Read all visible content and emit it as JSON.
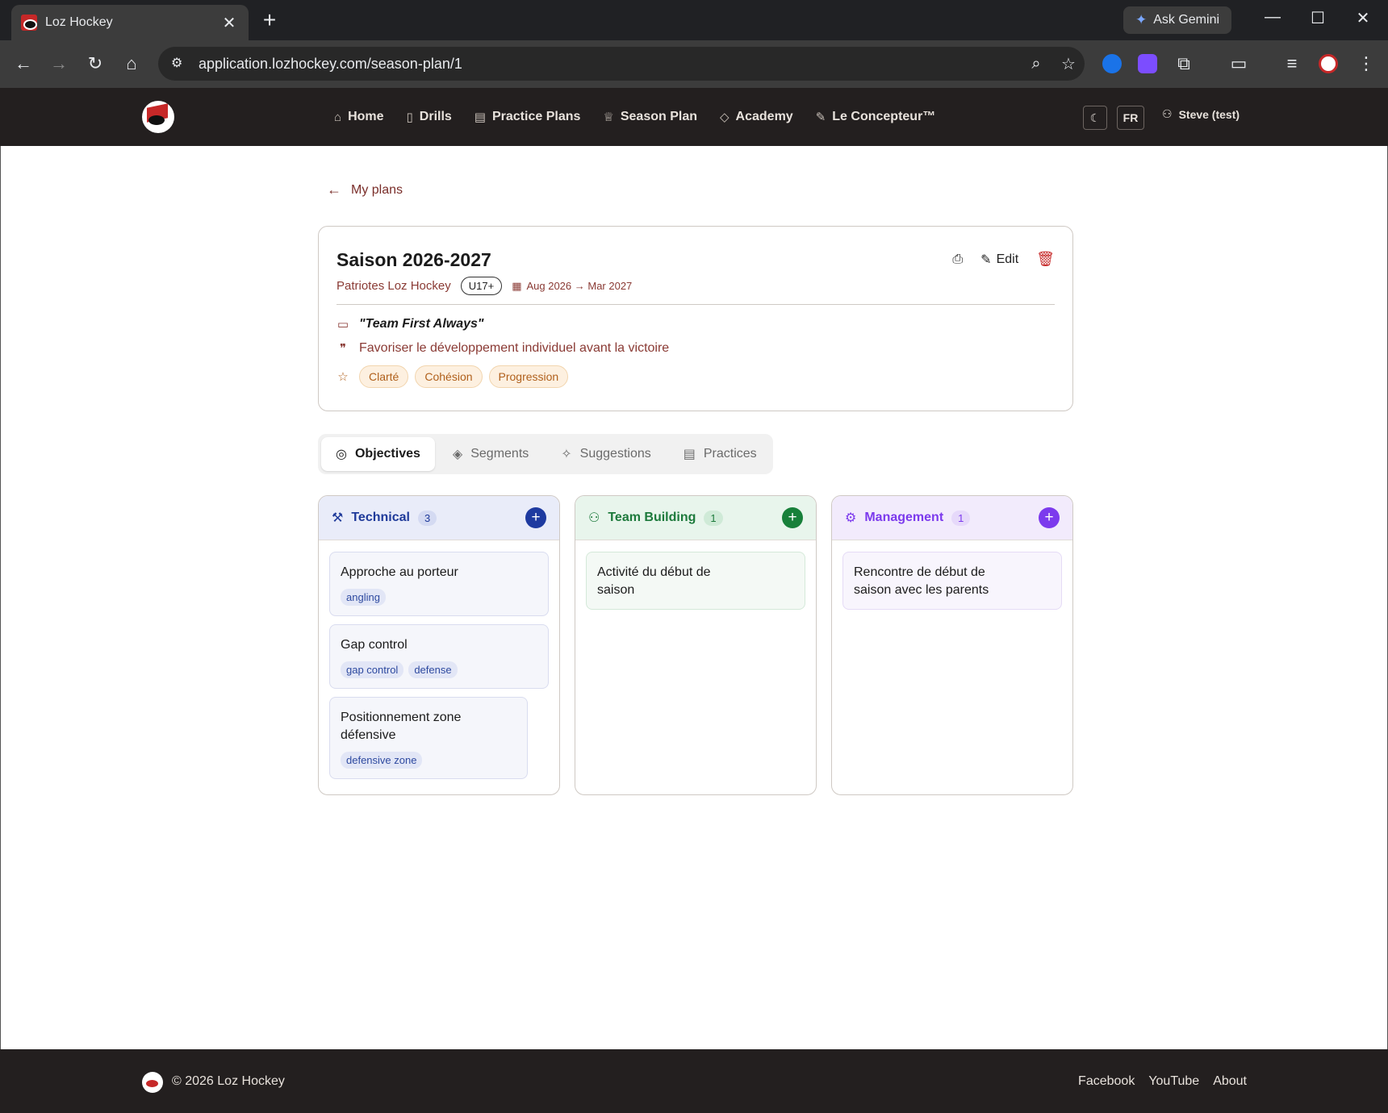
{
  "browser": {
    "tab_title": "Loz Hockey",
    "url": "application.lozhockey.com/season-plan/1",
    "gemini_label": "Ask Gemini"
  },
  "header": {
    "nav": [
      {
        "label": "Home",
        "icon": "home-icon"
      },
      {
        "label": "Drills",
        "icon": "book-icon"
      },
      {
        "label": "Practice Plans",
        "icon": "clipboard-icon"
      },
      {
        "label": "Season Plan",
        "icon": "trophy-icon"
      },
      {
        "label": "Academy",
        "icon": "graduation-cap-icon"
      },
      {
        "label": "Le Concepteur™",
        "icon": "pencil-icon"
      }
    ],
    "lang": "FR",
    "user": "Steve (test)"
  },
  "page": {
    "back_label": "My plans"
  },
  "plan": {
    "title": "Saison 2026-2027",
    "team": "Patriotes Loz Hockey",
    "age": "U17+",
    "dates": "Aug 2026 → Mar 2027",
    "edit_label": "Edit",
    "motto": "\"Team First Always\"",
    "philosophy": "Favoriser le développement individuel avant la victoire",
    "values": [
      "Clarté",
      "Cohésion",
      "Progression"
    ]
  },
  "tabs": [
    {
      "label": "Objectives",
      "icon": "target-icon"
    },
    {
      "label": "Segments",
      "icon": "layers-icon"
    },
    {
      "label": "Suggestions",
      "icon": "sparkles-icon"
    },
    {
      "label": "Practices",
      "icon": "clipboard-icon"
    }
  ],
  "columns": {
    "technical": {
      "name": "Technical",
      "count": "3",
      "items": [
        {
          "title": "Approche au porteur",
          "tags": [
            "angling"
          ]
        },
        {
          "title": "Gap control",
          "tags": [
            "gap control",
            "defense"
          ]
        },
        {
          "title": "Positionnement zone défensive",
          "tags": [
            "defensive zone"
          ]
        }
      ]
    },
    "team_building": {
      "name": "Team Building",
      "count": "1",
      "items": [
        {
          "title": "Activité du début de saison"
        }
      ]
    },
    "management": {
      "name": "Management",
      "count": "1",
      "items": [
        {
          "title": "Rencontre de début de saison avec les parents"
        }
      ]
    }
  },
  "footer": {
    "copyright": "© 2026 Loz Hockey",
    "links": [
      "Facebook",
      "YouTube",
      "About"
    ]
  }
}
